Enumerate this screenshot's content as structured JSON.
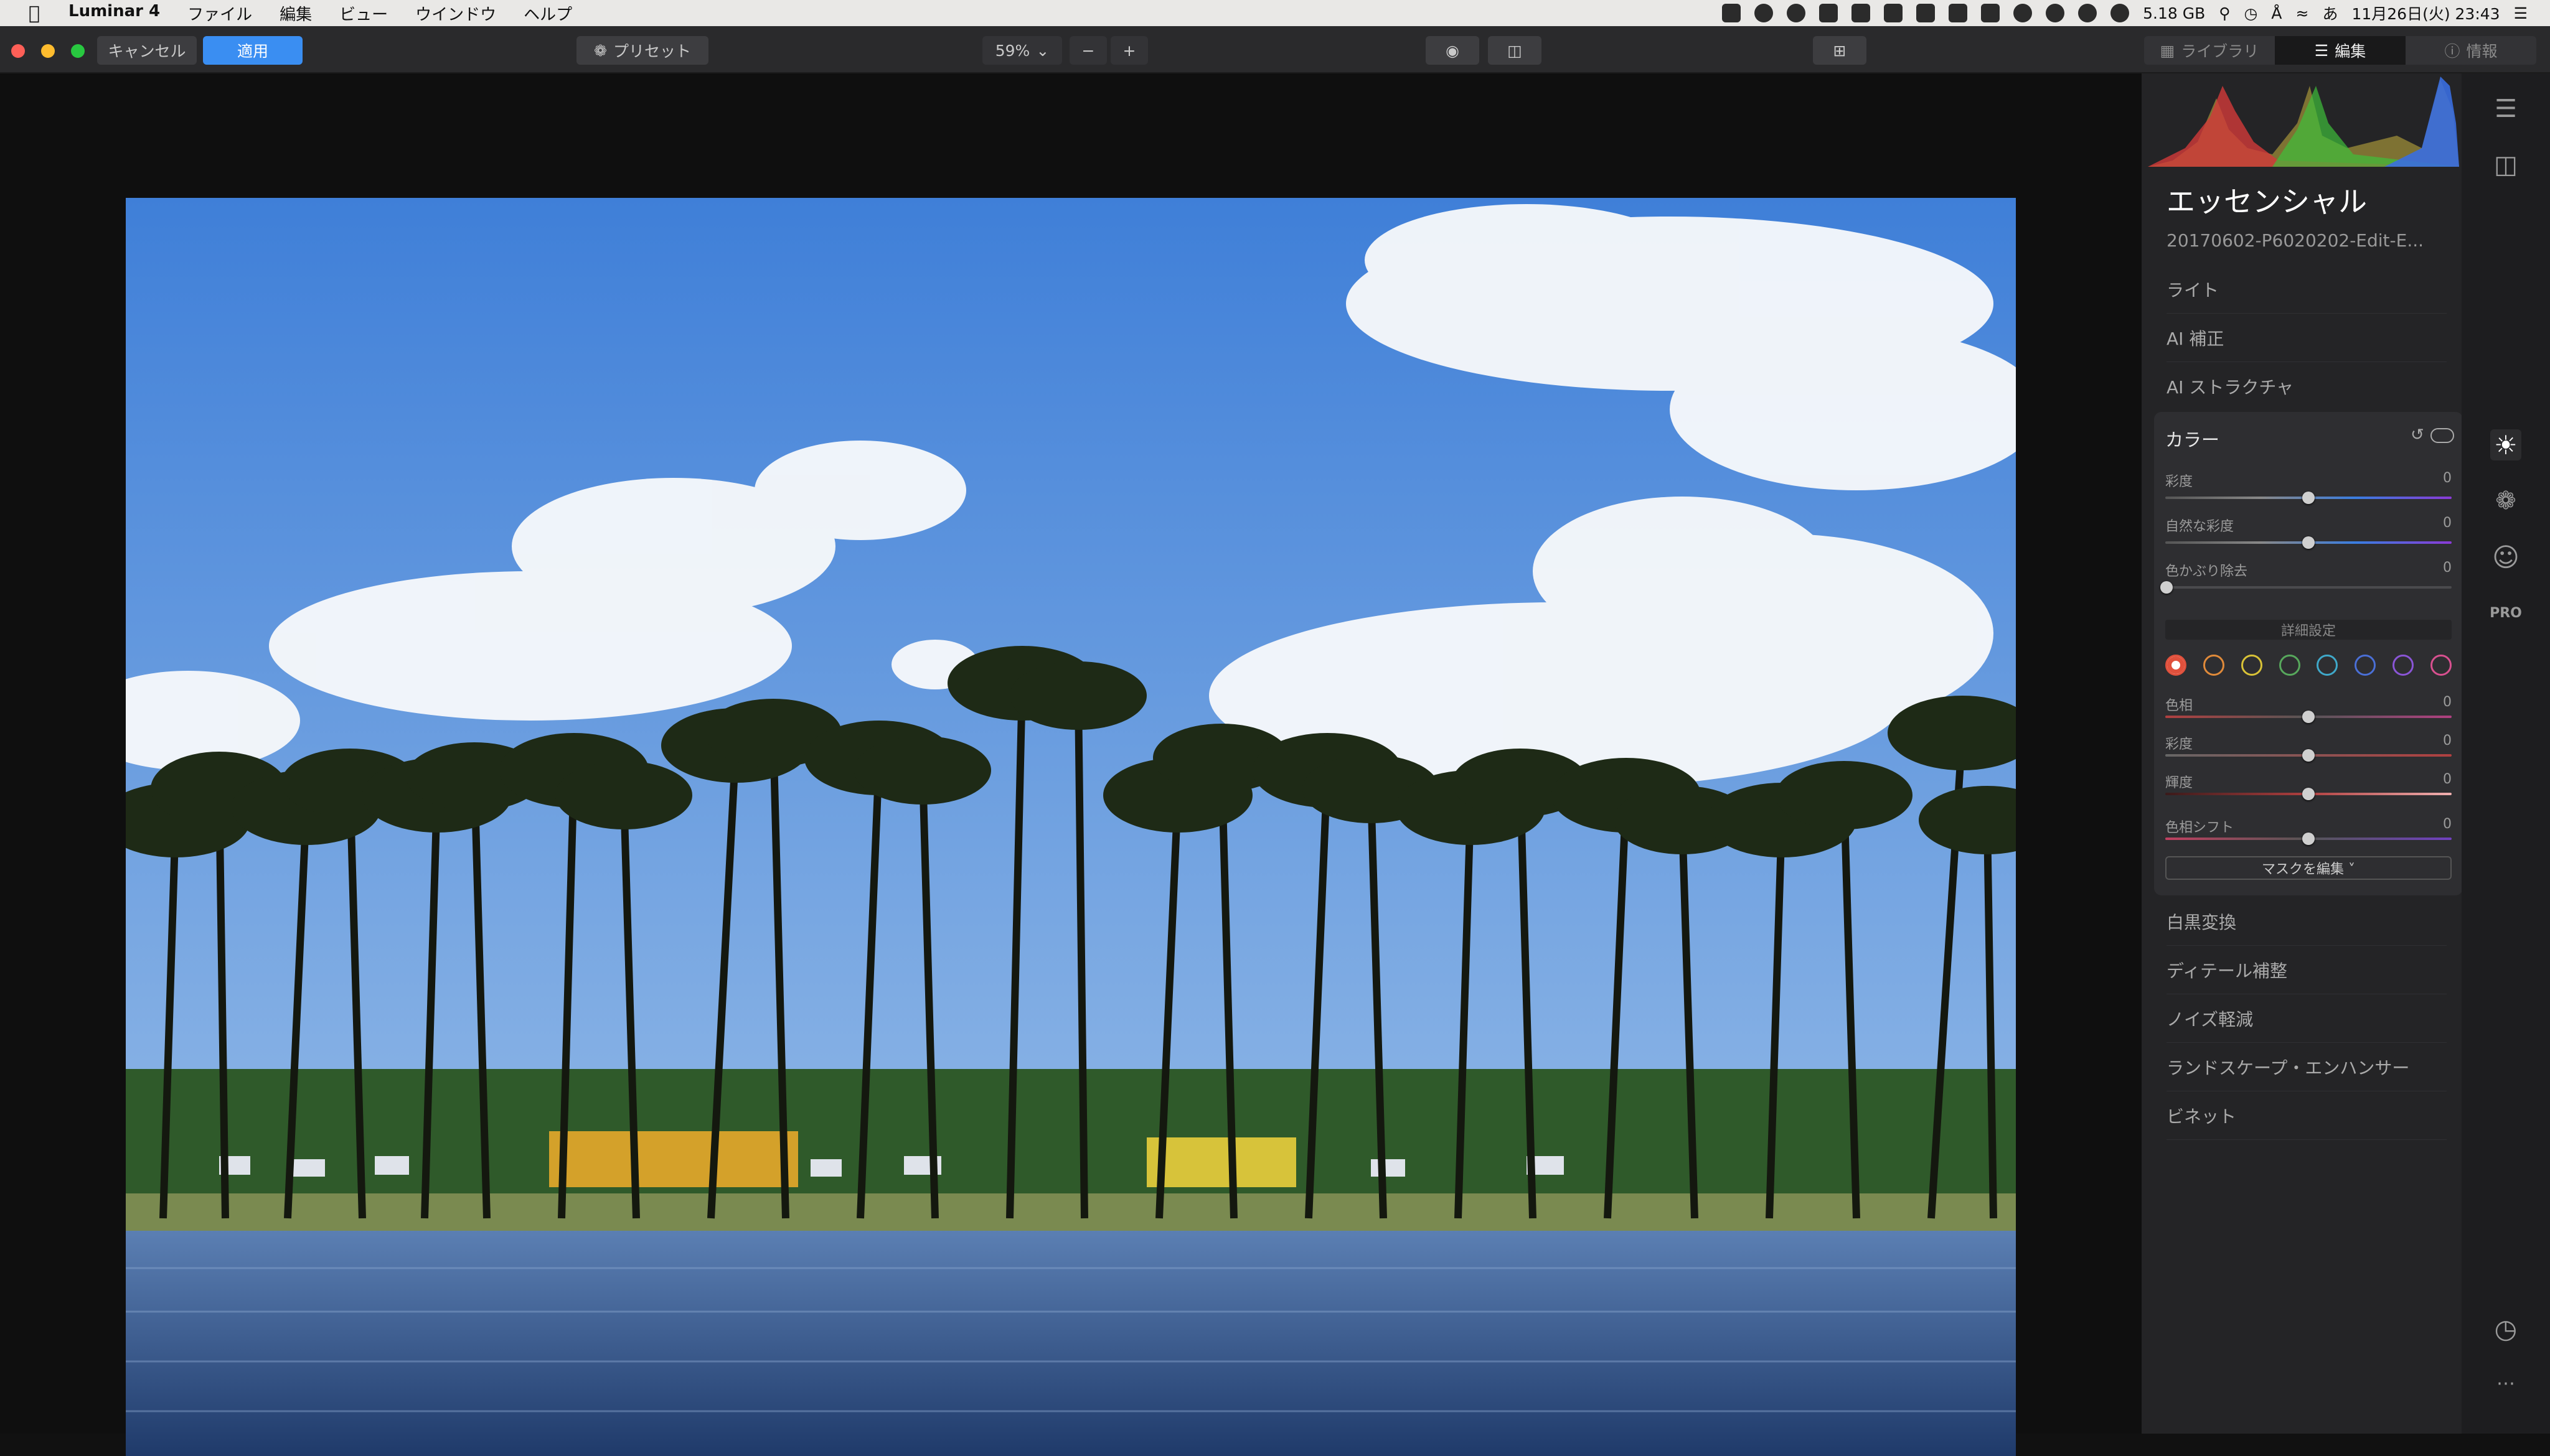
{
  "menubar": {
    "apple_icon": "apple-icon",
    "app_name": "Luminar 4",
    "items": [
      "ファイル",
      "編集",
      "ビュー",
      "ウインドウ",
      "ヘルプ"
    ],
    "storage": "5.18 GB",
    "datetime": "11月26日(火)  23:43",
    "input_method": "あ"
  },
  "toolbar": {
    "cancel_label": "キャンセル",
    "apply_label": "適用",
    "preset_label": "プリセット",
    "zoom_value": "59%",
    "zoom_minus": "−",
    "zoom_plus": "+",
    "tabs": [
      {
        "label": "ライブラリ",
        "icon": "library-icon"
      },
      {
        "label": "編集",
        "icon": "sliders-icon"
      },
      {
        "label": "情報",
        "icon": "info-icon"
      }
    ]
  },
  "panel": {
    "title": "エッセンシャル",
    "filename": "20170602-P6020202-Edit-E...",
    "sections_above": [
      "ライト",
      "AI 補正",
      "AI ストラクチャ"
    ],
    "color_card": {
      "header": "カラー",
      "sliders": [
        {
          "label": "彩度",
          "value": "0",
          "position": 0.5
        },
        {
          "label": "自然な彩度",
          "value": "0",
          "position": 0.5
        },
        {
          "label": "色かぶり除去",
          "value": "0",
          "position": 0.0
        }
      ],
      "detail_label": "詳細設定",
      "swatches": [
        "#e0503c",
        "#e08a3a",
        "#d8c237",
        "#57a85c",
        "#3fa8c9",
        "#4a6fd6",
        "#8a55d6",
        "#d8508f"
      ],
      "hsl_sliders": [
        {
          "label": "色相",
          "value": "0",
          "position": 0.5
        },
        {
          "label": "彩度",
          "value": "0",
          "position": 0.5
        },
        {
          "label": "輝度",
          "value": "0",
          "position": 0.5
        },
        {
          "label": "色相シフト",
          "value": "0",
          "position": 0.5
        }
      ],
      "mask_label": "マスクを編集 ˅"
    },
    "sections_below": [
      "白黒変換",
      "ディテール補整",
      "ノイズ軽減",
      "ランドスケープ・エンハンサー",
      "ビネット"
    ]
  },
  "rail_icons": [
    "layers-icon",
    "canvas-icon",
    "sun-icon",
    "palette-icon",
    "smiley-icon",
    "pro-icon",
    "history-icon",
    "more-icon"
  ],
  "rail_pro_label": "PRO"
}
